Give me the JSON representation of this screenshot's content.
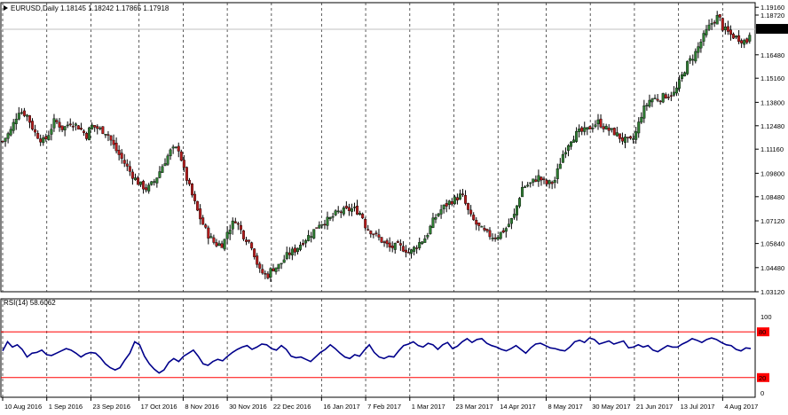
{
  "chart_data": [
    {
      "type": "candlestick",
      "symbol": "EURUSD",
      "timeframe": "Daily",
      "header_values": "1.18145 1.18242 1.17865 1.17918",
      "price_label": "1.17918",
      "y_ticks": [
        "1.19160",
        "1.18720",
        "1.16480",
        "1.15160",
        "1.13800",
        "1.12480",
        "1.11160",
        "1.09800",
        "1.08480",
        "1.07120",
        "1.05840",
        "1.04480",
        "1.03120"
      ],
      "x_ticks": [
        "10 Aug 2016",
        "1 Sep 2016",
        "23 Sep 2016",
        "17 Oct 2016",
        "8 Nov 2016",
        "30 Nov 2016",
        "22 Dec 2016",
        "16 Jan 2017",
        "7 Feb 2017",
        "1 Mar 2017",
        "23 Mar 2017",
        "14 Apr 2017",
        "8 May 2017",
        "30 May 2017",
        "21 Jun 2017",
        "13 Jul 2017",
        "4 Aug 2017"
      ],
      "ylim": [
        1.0312,
        1.1942
      ],
      "bull_color": "#2e7d32",
      "bear_color": "#b71c1c",
      "close_path": [
        {
          "d": "10 Aug 2016",
          "v": 1.116
        },
        {
          "d": "14 Aug 2016",
          "v": 1.122
        },
        {
          "d": "18 Aug 2016",
          "v": 1.1335
        },
        {
          "d": "22 Aug 2016",
          "v": 1.131
        },
        {
          "d": "26 Aug 2016",
          "v": 1.121
        },
        {
          "d": "30 Aug 2016",
          "v": 1.116
        },
        {
          "d": "1 Sep 2016",
          "v": 1.118
        },
        {
          "d": "5 Sep 2016",
          "v": 1.128
        },
        {
          "d": "9 Sep 2016",
          "v": 1.123
        },
        {
          "d": "13 Sep 2016",
          "v": 1.127
        },
        {
          "d": "17 Sep 2016",
          "v": 1.124
        },
        {
          "d": "21 Sep 2016",
          "v": 1.119
        },
        {
          "d": "23 Sep 2016",
          "v": 1.125
        },
        {
          "d": "27 Sep 2016",
          "v": 1.123
        },
        {
          "d": "1 Oct 2016",
          "v": 1.121
        },
        {
          "d": "5 Oct 2016",
          "v": 1.112
        },
        {
          "d": "9 Oct 2016",
          "v": 1.105
        },
        {
          "d": "13 Oct 2016",
          "v": 1.098
        },
        {
          "d": "17 Oct 2016",
          "v": 1.092
        },
        {
          "d": "21 Oct 2016",
          "v": 1.089
        },
        {
          "d": "25 Oct 2016",
          "v": 1.094
        },
        {
          "d": "29 Oct 2016",
          "v": 1.103
        },
        {
          "d": "2 Nov 2016",
          "v": 1.111
        },
        {
          "d": "6 Nov 2016",
          "v": 1.112
        },
        {
          "d": "8 Nov 2016",
          "v": 1.101
        },
        {
          "d": "12 Nov 2016",
          "v": 1.087
        },
        {
          "d": "16 Nov 2016",
          "v": 1.074
        },
        {
          "d": "20 Nov 2016",
          "v": 1.064
        },
        {
          "d": "24 Nov 2016",
          "v": 1.058
        },
        {
          "d": "28 Nov 2016",
          "v": 1.058
        },
        {
          "d": "30 Nov 2016",
          "v": 1.065
        },
        {
          "d": "4 Dec 2016",
          "v": 1.072
        },
        {
          "d": "8 Dec 2016",
          "v": 1.063
        },
        {
          "d": "12 Dec 2016",
          "v": 1.058
        },
        {
          "d": "16 Dec 2016",
          "v": 1.043
        },
        {
          "d": "20 Dec 2016",
          "v": 1.04
        },
        {
          "d": "22 Dec 2016",
          "v": 1.044
        },
        {
          "d": "26 Dec 2016",
          "v": 1.046
        },
        {
          "d": "30 Dec 2016",
          "v": 1.052
        },
        {
          "d": "3 Jan 2017",
          "v": 1.055
        },
        {
          "d": "7 Jan 2017",
          "v": 1.06
        },
        {
          "d": "11 Jan 2017",
          "v": 1.064
        },
        {
          "d": "15 Jan 2017",
          "v": 1.07
        },
        {
          "d": "16 Jan 2017",
          "v": 1.07
        },
        {
          "d": "20 Jan 2017",
          "v": 1.072
        },
        {
          "d": "24 Jan 2017",
          "v": 1.076
        },
        {
          "d": "28 Jan 2017",
          "v": 1.077
        },
        {
          "d": "1 Feb 2017",
          "v": 1.078
        },
        {
          "d": "5 Feb 2017",
          "v": 1.075
        },
        {
          "d": "7 Feb 2017",
          "v": 1.068
        },
        {
          "d": "11 Feb 2017",
          "v": 1.064
        },
        {
          "d": "15 Feb 2017",
          "v": 1.06
        },
        {
          "d": "19 Feb 2017",
          "v": 1.056
        },
        {
          "d": "23 Feb 2017",
          "v": 1.057
        },
        {
          "d": "27 Feb 2017",
          "v": 1.055
        },
        {
          "d": "1 Mar 2017",
          "v": 1.053
        },
        {
          "d": "5 Mar 2017",
          "v": 1.058
        },
        {
          "d": "9 Mar 2017",
          "v": 1.062
        },
        {
          "d": "13 Mar 2017",
          "v": 1.072
        },
        {
          "d": "17 Mar 2017",
          "v": 1.078
        },
        {
          "d": "21 Mar 2017",
          "v": 1.082
        },
        {
          "d": "23 Mar 2017",
          "v": 1.083
        },
        {
          "d": "27 Mar 2017",
          "v": 1.086
        },
        {
          "d": "31 Mar 2017",
          "v": 1.074
        },
        {
          "d": "4 Apr 2017",
          "v": 1.068
        },
        {
          "d": "8 Apr 2017",
          "v": 1.064
        },
        {
          "d": "12 Apr 2017",
          "v": 1.062
        },
        {
          "d": "14 Apr 2017",
          "v": 1.063
        },
        {
          "d": "18 Apr 2017",
          "v": 1.067
        },
        {
          "d": "22 Apr 2017",
          "v": 1.074
        },
        {
          "d": "26 Apr 2017",
          "v": 1.09
        },
        {
          "d": "30 Apr 2017",
          "v": 1.092
        },
        {
          "d": "4 May 2017",
          "v": 1.096
        },
        {
          "d": "8 May 2017",
          "v": 1.092
        },
        {
          "d": "12 May 2017",
          "v": 1.093
        },
        {
          "d": "16 May 2017",
          "v": 1.108
        },
        {
          "d": "20 May 2017",
          "v": 1.117
        },
        {
          "d": "24 May 2017",
          "v": 1.121
        },
        {
          "d": "28 May 2017",
          "v": 1.122
        },
        {
          "d": "30 May 2017",
          "v": 1.124
        },
        {
          "d": "3 Jun 2017",
          "v": 1.127
        },
        {
          "d": "7 Jun 2017",
          "v": 1.123
        },
        {
          "d": "11 Jun 2017",
          "v": 1.121
        },
        {
          "d": "15 Jun 2017",
          "v": 1.117
        },
        {
          "d": "19 Jun 2017",
          "v": 1.116
        },
        {
          "d": "21 Jun 2017",
          "v": 1.118
        },
        {
          "d": "25 Jun 2017",
          "v": 1.133
        },
        {
          "d": "29 Jun 2017",
          "v": 1.14
        },
        {
          "d": "3 Jul 2017",
          "v": 1.14
        },
        {
          "d": "7 Jul 2017",
          "v": 1.142
        },
        {
          "d": "11 Jul 2017",
          "v": 1.143
        },
        {
          "d": "13 Jul 2017",
          "v": 1.148
        },
        {
          "d": "17 Jul 2017",
          "v": 1.159
        },
        {
          "d": "21 Jul 2017",
          "v": 1.165
        },
        {
          "d": "25 Jul 2017",
          "v": 1.174
        },
        {
          "d": "29 Jul 2017",
          "v": 1.182
        },
        {
          "d": "2 Aug 2017",
          "v": 1.187
        },
        {
          "d": "4 Aug 2017",
          "v": 1.18
        },
        {
          "d": "8 Aug 2017",
          "v": 1.176
        },
        {
          "d": "12 Aug 2017",
          "v": 1.174
        },
        {
          "d": "16 Aug 2017",
          "v": 1.172
        },
        {
          "d": "18 Aug 2017",
          "v": 1.1792
        }
      ]
    },
    {
      "type": "line",
      "indicator": "RSI(14)",
      "header_value": "58.6062",
      "y_ticks": [
        "100",
        "80",
        "20",
        "0"
      ],
      "ylim": [
        0,
        100
      ],
      "levels": [
        80,
        20
      ],
      "level_color": "#ff0000",
      "line_color": "#00008b",
      "values": [
        55,
        67,
        60,
        63,
        57,
        47,
        52,
        53,
        56,
        50,
        49,
        52,
        55,
        58,
        56,
        52,
        47,
        51,
        53,
        52,
        46,
        38,
        33,
        30,
        33,
        43,
        52,
        67,
        63,
        48,
        38,
        31,
        26,
        30,
        40,
        45,
        41,
        48,
        52,
        56,
        48,
        38,
        36,
        41,
        44,
        42,
        48,
        53,
        57,
        60,
        62,
        57,
        60,
        64,
        63,
        58,
        56,
        62,
        57,
        48,
        46,
        47,
        44,
        41,
        47,
        53,
        57,
        63,
        58,
        52,
        47,
        45,
        50,
        48,
        56,
        63,
        53,
        47,
        45,
        48,
        47,
        55,
        62,
        64,
        67,
        62,
        60,
        65,
        63,
        57,
        63,
        66,
        58,
        61,
        67,
        71,
        66,
        70,
        71,
        65,
        62,
        60,
        57,
        55,
        58,
        62,
        57,
        52,
        59,
        64,
        65,
        62,
        59,
        58,
        56,
        55,
        60,
        67,
        69,
        66,
        72,
        70,
        64,
        66,
        68,
        64,
        66,
        68,
        59,
        60,
        63,
        60,
        62,
        56,
        54,
        58,
        62,
        60,
        60,
        64,
        67,
        71,
        69,
        66,
        70,
        72,
        70,
        66,
        63,
        62,
        57,
        55,
        59,
        58
      ]
    }
  ]
}
